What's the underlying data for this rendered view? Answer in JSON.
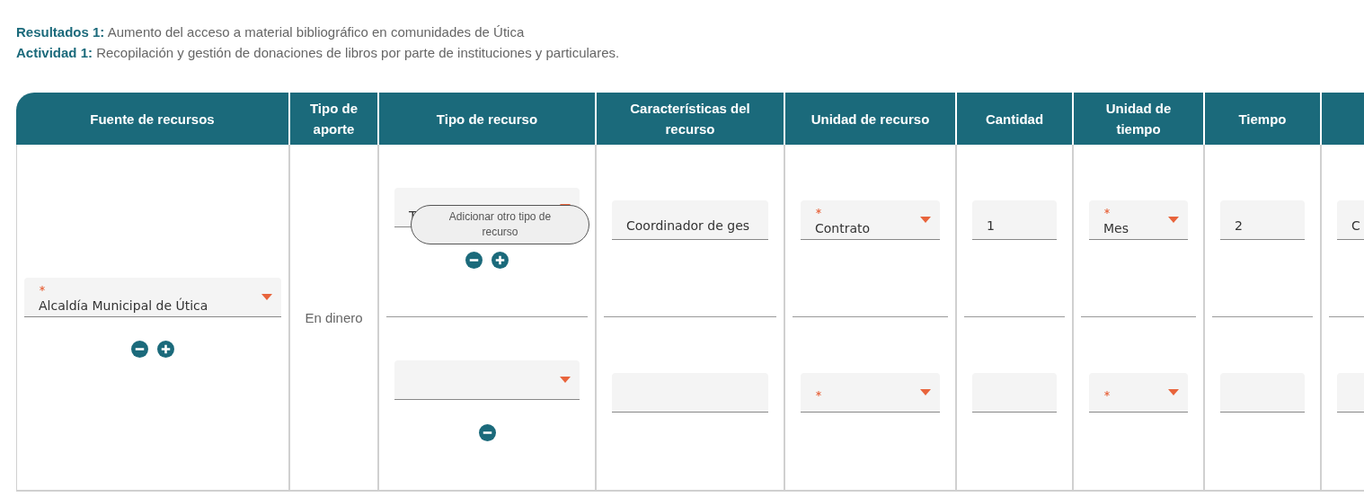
{
  "resultado": {
    "label": "Resultados 1:",
    "text": "Aumento del acceso a material bibliográfico en comunidades de Útica"
  },
  "actividad": {
    "label": "Actividad 1:",
    "text": "Recopilación y gestión de donaciones de libros por parte de instituciones y particulares."
  },
  "columns": [
    "Fuente de recursos",
    "Tipo de aporte",
    "Tipo de recurso",
    "Características del recurso",
    "Unidad de recurso",
    "Cantidad",
    "Unidad de tiempo",
    "Tiempo"
  ],
  "row": {
    "fuente": {
      "kind": "select",
      "required": true,
      "value": "Alcaldía Municipal de Útica",
      "actions": [
        {
          "kind": "remove"
        },
        {
          "kind": "add"
        }
      ]
    },
    "tipo_aporte": "En dinero",
    "recursos": [
      {
        "cells": [
          {
            "kind": "select",
            "required": false,
            "value": "T",
            "tooltip": "Adicionar otro tipo de recurso",
            "actions": [
              {
                "kind": "remove"
              },
              {
                "kind": "add"
              }
            ]
          },
          {
            "kind": "input",
            "value": "Coordinador de ges"
          },
          {
            "kind": "select",
            "required": true,
            "value": "Contrato"
          },
          {
            "kind": "input",
            "value": "1"
          },
          {
            "kind": "select",
            "required": true,
            "value": "Mes"
          },
          {
            "kind": "input",
            "value": "2"
          },
          {
            "kind": "input",
            "value": "C"
          }
        ]
      },
      {
        "cells": [
          {
            "kind": "select",
            "required": false,
            "actions": [
              {
                "kind": "remove"
              }
            ]
          },
          {
            "kind": "input"
          },
          {
            "kind": "select",
            "required": true
          },
          {
            "kind": "input"
          },
          {
            "kind": "select",
            "required": true
          },
          {
            "kind": "input"
          },
          {
            "kind": "input"
          }
        ]
      }
    ]
  }
}
